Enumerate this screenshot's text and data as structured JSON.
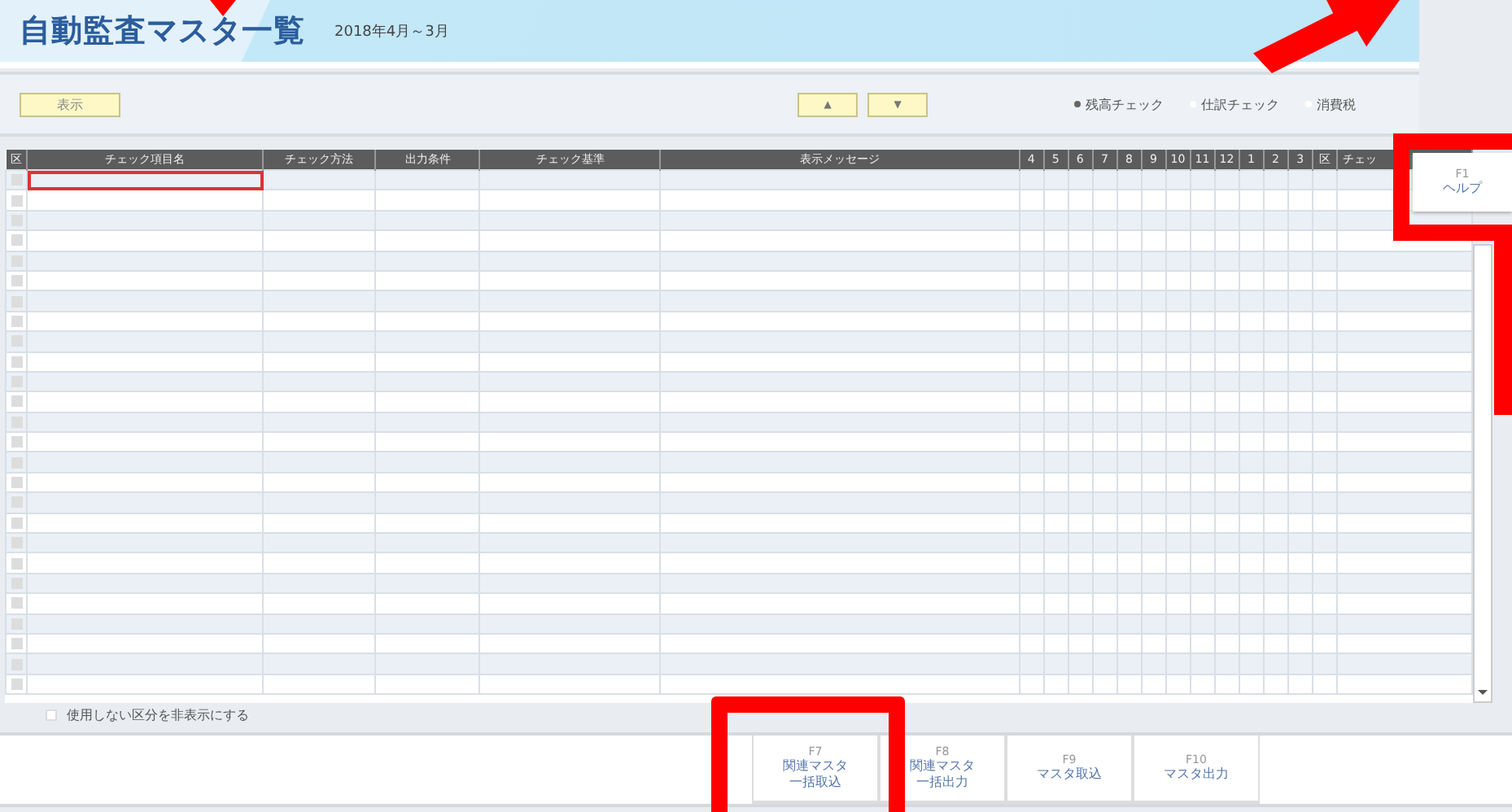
{
  "header": {
    "title": "自動監査マスタ一覧",
    "period": "2018年4月～3月"
  },
  "toolbar": {
    "show_button": "表示",
    "up_button": "▲",
    "down_button": "▼",
    "options": [
      {
        "label": "残高チェック",
        "selected": true
      },
      {
        "label": "仕訳チェック",
        "selected": false
      },
      {
        "label": "消費税",
        "selected": false
      }
    ]
  },
  "help_key": {
    "key": "F1",
    "label": "ヘルプ"
  },
  "table": {
    "columns": [
      "区",
      "チェック項目名",
      "チェック方法",
      "出力条件",
      "チェック基準",
      "表示メッセージ",
      "4",
      "5",
      "6",
      "7",
      "8",
      "9",
      "10",
      "11",
      "12",
      "1",
      "2",
      "3",
      "区",
      "チェッ"
    ],
    "rows": [
      {
        "selected": true
      },
      {
        "selected": false
      },
      {
        "selected": false
      },
      {
        "selected": false
      },
      {
        "selected": false
      },
      {
        "selected": false
      },
      {
        "selected": false
      },
      {
        "selected": false
      },
      {
        "selected": false
      },
      {
        "selected": false
      },
      {
        "selected": false
      },
      {
        "selected": false
      },
      {
        "selected": false
      },
      {
        "selected": false
      },
      {
        "selected": false
      },
      {
        "selected": false
      },
      {
        "selected": false
      },
      {
        "selected": false
      },
      {
        "selected": false
      },
      {
        "selected": false
      },
      {
        "selected": false
      },
      {
        "selected": false
      },
      {
        "selected": false
      },
      {
        "selected": false
      },
      {
        "selected": false
      },
      {
        "selected": false
      }
    ]
  },
  "hide_unused": {
    "label": "使用しない区分を非表示にする",
    "checked": false
  },
  "function_keys": [
    {
      "key": "F7",
      "label": "関連マスタ一括取込"
    },
    {
      "key": "F8",
      "label": "関連マスタ一括出力"
    },
    {
      "key": "F9",
      "label": "マスタ取込"
    },
    {
      "key": "F10",
      "label": "マスタ出力"
    }
  ],
  "annotations": [
    {
      "kind": "pointer"
    },
    {
      "kind": "arrow"
    },
    {
      "kind": "frame"
    },
    {
      "kind": "box"
    }
  ]
}
